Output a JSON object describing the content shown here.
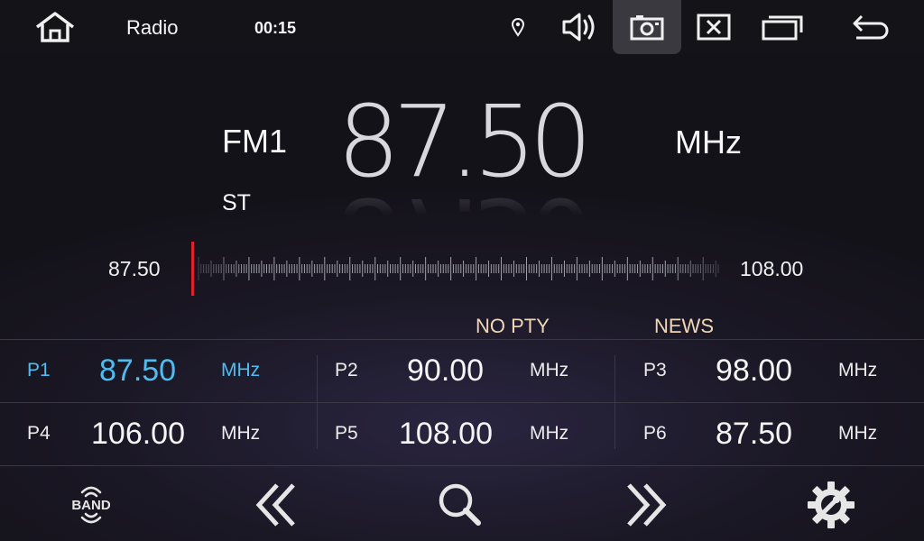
{
  "status_bar": {
    "app_title": "Radio",
    "clock": "00:15",
    "icons": [
      "home-icon",
      "location-icon",
      "volume-icon",
      "camera-icon",
      "close-window-icon",
      "windows-icon",
      "back-icon"
    ]
  },
  "display": {
    "band": "FM1",
    "stereo": "ST",
    "frequency": "87.50",
    "unit": "MHz"
  },
  "scale": {
    "min_label": "87.50",
    "max_label": "108.00",
    "min": 87.5,
    "max": 108.0,
    "current": 87.5
  },
  "tags": {
    "pty": "NO PTY",
    "news": "NEWS"
  },
  "presets": [
    {
      "label": "P1",
      "freq": "87.50",
      "unit": "MHz",
      "active": true
    },
    {
      "label": "P2",
      "freq": "90.00",
      "unit": "MHz",
      "active": false
    },
    {
      "label": "P3",
      "freq": "98.00",
      "unit": "MHz",
      "active": false
    },
    {
      "label": "P4",
      "freq": "106.00",
      "unit": "MHz",
      "active": false
    },
    {
      "label": "P5",
      "freq": "108.00",
      "unit": "MHz",
      "active": false
    },
    {
      "label": "P6",
      "freq": "87.50",
      "unit": "MHz",
      "active": false
    }
  ],
  "controls": {
    "band_label": "BAND"
  },
  "colors": {
    "accent": "#4fbdf0",
    "needle": "#e0202a",
    "tag": "#f0d7b8"
  }
}
